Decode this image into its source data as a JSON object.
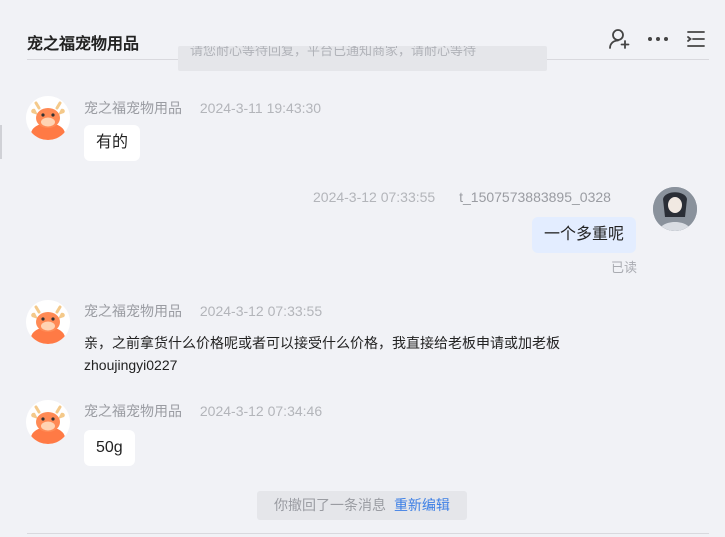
{
  "header": {
    "title": "宠之福宠物用品",
    "icons": [
      "add-user-icon",
      "more-icon",
      "list-icon"
    ]
  },
  "system_top_text": "请您耐心等待回复，平台已通知商家，请耐心等待",
  "messages": [
    {
      "sender": "宠之福宠物用品",
      "time": "2024-3-11 19:43:30",
      "text": "有的"
    },
    {
      "sender": "t_1507573883895_0328",
      "time": "2024-3-12 07:33:55",
      "text": "一个多重呢",
      "status": "已读"
    },
    {
      "sender": "宠之福宠物用品",
      "time": "2024-3-12 07:33:55",
      "line1": "亲，之前拿货什么价格呢或者可以接受什么价格，我直接给老板申请或加老板",
      "line2": "zhoujingyi0227"
    },
    {
      "sender": "宠之福宠物用品",
      "time": "2024-3-12 07:34:46",
      "text": "50g"
    }
  ],
  "recall": {
    "text": "你撤回了一条消息",
    "link": "重新编辑"
  },
  "colors": {
    "background": "#f1f2f6",
    "my_bubble": "#e3edff",
    "link": "#3d7fe5",
    "avatar_orange": "#ff7a45"
  }
}
